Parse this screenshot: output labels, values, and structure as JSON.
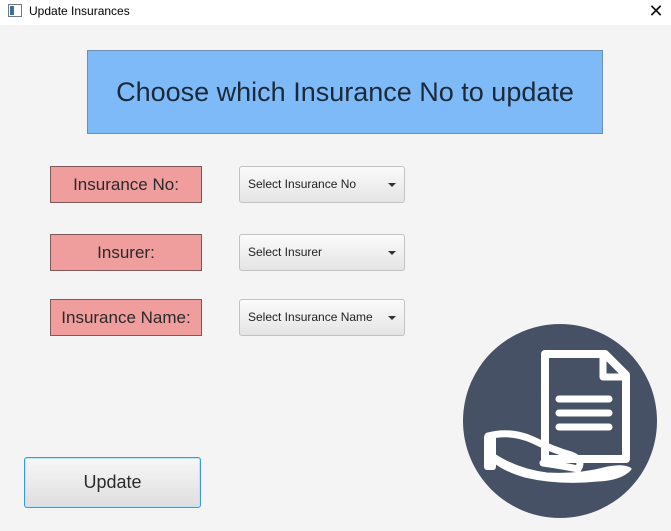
{
  "window": {
    "title": "Update Insurances",
    "close_glyph": "✕"
  },
  "banner": {
    "text": "Choose which Insurance No to update"
  },
  "fields": [
    {
      "label": "Insurance No:",
      "placeholder": "Select Insurance No"
    },
    {
      "label": "Insurer:",
      "placeholder": "Select Insurer"
    },
    {
      "label": "Insurance Name:",
      "placeholder": "Select Insurance Name"
    }
  ],
  "actions": {
    "update_label": "Update"
  },
  "icons": {
    "app": "app-window-icon",
    "close": "close-icon",
    "dropdown": "chevron-down-icon",
    "logo": "hand-holding-document-icon"
  },
  "colors": {
    "banner_bg": "#7fbaf8",
    "label_bg": "#f09d9d",
    "logo_circle": "#475166",
    "button_focus_border": "#3a9bd5",
    "window_bg": "#f4f4f4"
  }
}
